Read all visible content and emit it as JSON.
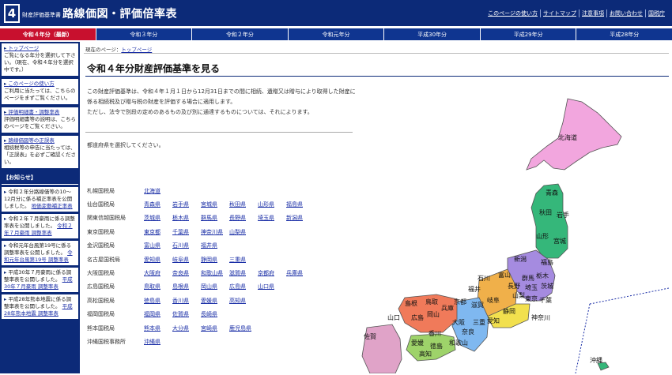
{
  "header": {
    "logo_number": "4",
    "logo_subtitle": "財産評価基準書",
    "logo_title": "路線価図・評価倍率表",
    "links": [
      "このページの使い方",
      "サイトマップ",
      "注意事項",
      "お問い合わせ",
      "国税庁"
    ]
  },
  "tabs": [
    "令和４年分（最新）",
    "令和３年分",
    "令和２年分",
    "令和元年分",
    "平成30年分",
    "平成29年分",
    "平成28年分"
  ],
  "sidebar": {
    "boxes": [
      {
        "title": "トップページ",
        "text": "ご覧になる年分を選択して下さい。（現在、令和４年分を選択中です。）"
      },
      {
        "title": "このページの使い方",
        "text": "ご利用に当たっては、こちらのページをまずご覧ください。"
      },
      {
        "title": "評価明細書・調整率表",
        "text": "評価明細書等の説明は、こちらのページをご覧ください。"
      },
      {
        "title": "路線価図等の正誤表",
        "text": "相続税等の申告に当たっては、「正誤表」を必ずご確認ください。"
      }
    ],
    "news_heading": "【お知らせ】",
    "news": [
      {
        "text": "令和２年分路線価等の10～12月分に係る補正率表を公開しました。",
        "link": "地価変動補正率表"
      },
      {
        "text": "令和２年７月豪雨に係る調整率表を公開しました。",
        "link": "令和２年７月豪雨 調整率表"
      },
      {
        "text": "令和元年台風第19号に係る調整率表を公開しました。",
        "link": "令和元年台風第19号 調整率表"
      },
      {
        "text": "平成30年７月豪雨に係る調整率表を公開しました。",
        "link": "平成30年７月豪雨 調整率表"
      },
      {
        "text": "平成28年熊本地震に係る調整率表を公開しました。",
        "link": "平成28年熊本地震 調整率表"
      }
    ]
  },
  "main": {
    "breadcrumb_prefix": "現在のページ：",
    "breadcrumb_link": "トップページ",
    "title": "令和４年分財産評価基準を見る",
    "intro": [
      "この財産評価基準は、令和４年１月１日から12月31日までの間に相続、遺贈又は贈与により取得した財産に係る相続税及び贈与税の財産を評価する場合に適用します。",
      "ただし、法令で別段の定めのあるもの及び別に通達するものについては、それによります。"
    ],
    "prompt": "都道府県を選択してください。",
    "bureaus": [
      {
        "name": "札幌国税局",
        "prefs": [
          "北海道"
        ]
      },
      {
        "name": "仙台国税局",
        "prefs": [
          "青森県",
          "岩手県",
          "宮城県",
          "秋田県",
          "山形県",
          "福島県"
        ]
      },
      {
        "name": "関東信越国税局",
        "prefs": [
          "茨城県",
          "栃木県",
          "群馬県",
          "長野県",
          "埼玉県",
          "新潟県"
        ]
      },
      {
        "name": "東京国税局",
        "prefs": [
          "東京都",
          "千葉県",
          "神奈川県",
          "山梨県"
        ]
      },
      {
        "name": "金沢国税局",
        "prefs": [
          "富山県",
          "石川県",
          "福井県"
        ]
      },
      {
        "name": "名古屋国税局",
        "prefs": [
          "愛知県",
          "岐阜県",
          "静岡県",
          "三重県"
        ]
      },
      {
        "name": "大阪国税局",
        "prefs": [
          "大阪府",
          "奈良県",
          "和歌山県",
          "滋賀県",
          "京都府",
          "兵庫県"
        ]
      },
      {
        "name": "広島国税局",
        "prefs": [
          "鳥取県",
          "島根県",
          "岡山県",
          "広島県",
          "山口県"
        ]
      },
      {
        "name": "高松国税局",
        "prefs": [
          "徳島県",
          "香川県",
          "愛媛県",
          "高知県"
        ]
      },
      {
        "name": "福岡国税局",
        "prefs": [
          "福岡県",
          "佐賀県",
          "長崎県"
        ]
      },
      {
        "name": "熊本国税局",
        "prefs": [
          "熊本県",
          "大分県",
          "宮崎県",
          "鹿児島県"
        ]
      },
      {
        "name": "沖縄国税事務所",
        "prefs": [
          "沖縄県"
        ]
      }
    ]
  },
  "map": {
    "labels": [
      "北海道",
      "青森",
      "秋田",
      "岩手",
      "山形",
      "宮城",
      "新潟",
      "福島",
      "石川",
      "富山",
      "群馬",
      "栃木",
      "長野",
      "福井",
      "山梨",
      "埼玉",
      "茨城",
      "東京",
      "千葉",
      "神奈川",
      "静岡",
      "愛知",
      "岐阜",
      "滋賀",
      "京都",
      "兵庫",
      "大阪",
      "奈良",
      "和歌山",
      "三重",
      "鳥取",
      "島根",
      "岡山",
      "広島",
      "山口",
      "香川",
      "徳島",
      "愛媛",
      "高知",
      "佐賀",
      "沖縄"
    ],
    "colors": {
      "hokkaido": "#f2a6de",
      "tohoku": "#35b77a",
      "kanto": "#a58be0",
      "tokai": "#e6c84b",
      "kinki": "#7fb8f0",
      "chugoku": "#f07a5a",
      "shikoku": "#9ed36a",
      "kyushu": "#e0a3c8"
    }
  }
}
